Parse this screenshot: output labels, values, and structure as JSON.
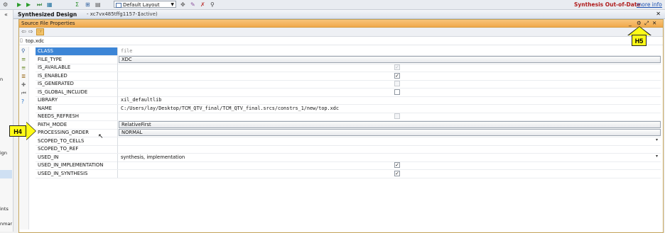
{
  "toolbar": {
    "icons": [
      "settings-icon",
      "run-icon",
      "run-all-icon",
      "step-icon",
      "bitstream-icon",
      "sum-icon",
      "schematic-icon",
      "report-icon",
      "layout-icon",
      "cross-icon",
      "probe-icon",
      "debug-icon"
    ],
    "layout_select": "Default Layout"
  },
  "status": {
    "text": "Synthesis Out-of-Date",
    "more_info": "more info"
  },
  "left_column": {
    "collapse_glyph": "«",
    "fragments": [
      "n",
      "ign",
      "ints",
      "nmar"
    ]
  },
  "design": {
    "title": "Synthesized Design",
    "part": "- xc7vx485tffg1157-1",
    "state": "(active)",
    "close_glyph": "✕"
  },
  "panel": {
    "title": "Source File Properties",
    "controls": [
      "_",
      "⚙",
      "⤢",
      "✕"
    ]
  },
  "file": {
    "name": "top.xdc"
  },
  "properties": [
    {
      "name": "CLASS",
      "value": "file",
      "kind": "text-mono",
      "selected": true
    },
    {
      "name": "FILE_TYPE",
      "value": "XDC",
      "kind": "combo"
    },
    {
      "name": "IS_AVAILABLE",
      "value": "✓",
      "kind": "check-disabled"
    },
    {
      "name": "IS_ENABLED",
      "value": "✓",
      "kind": "check"
    },
    {
      "name": "IS_GENERATED",
      "value": "",
      "kind": "check-disabled"
    },
    {
      "name": "IS_GLOBAL_INCLUDE",
      "value": "",
      "kind": "check"
    },
    {
      "name": "LIBRARY",
      "value": "xil_defaultlib",
      "kind": "text-mono"
    },
    {
      "name": "NAME",
      "value": "C:/Users/lay/Desktop/TCM_QTV_final/TCM_QTV_final.srcs/constrs_1/new/top.xdc",
      "kind": "text-mono"
    },
    {
      "name": "NEEDS_REFRESH",
      "value": "",
      "kind": "check-disabled"
    },
    {
      "name": "PATH_MODE",
      "value": "RelativeFirst",
      "kind": "combo"
    },
    {
      "name": "PROCESSING_ORDER",
      "value": "NORMAL",
      "kind": "combo"
    },
    {
      "name": "SCOPED_TO_CELLS",
      "value": "",
      "kind": "dropdown"
    },
    {
      "name": "SCOPED_TO_REF",
      "value": "",
      "kind": "text"
    },
    {
      "name": "USED_IN",
      "value": "synthesis, implementation",
      "kind": "dropdown"
    },
    {
      "name": "USED_IN_IMPLEMENTATION",
      "value": "✓",
      "kind": "check"
    },
    {
      "name": "USED_IN_SYNTHESIS",
      "value": "✓",
      "kind": "check"
    }
  ],
  "callouts": {
    "h4": "H4",
    "h5": "H5"
  }
}
